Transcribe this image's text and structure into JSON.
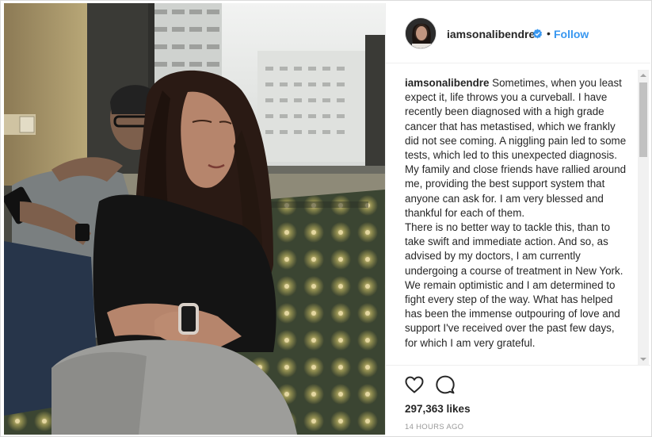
{
  "post": {
    "username": "iamsonalibendre",
    "dot": "•",
    "follow_label": "Follow",
    "caption_username": "iamsonalibendre",
    "caption_para1": "Sometimes, when you least expect it, life throws you a curveball. I have recently been diagnosed with a high grade cancer that has metastised, which we frankly did not see coming. A niggling pain led to some tests, which led to this unexpected diagnosis. My family and close friends have rallied around me, providing the best support system that anyone can ask for. I am very blessed and thankful for each of them.",
    "caption_para2": "There is no better way to tackle this, than to take swift and immediate action. And so, as advised by my doctors, I am currently undergoing a course of treatment in New York. We remain optimistic and I am determined to fight every step of the way. What has helped has been the immense outpouring of love and support I've received over the past few days, for which I am very grateful.",
    "likes": "297,363 likes",
    "timestamp": "14 HOURS AGO"
  },
  "icons": {
    "verified": "verified-badge-icon",
    "like": "heart-icon",
    "comment": "comment-bubble-icon"
  },
  "colors": {
    "link_blue": "#3897f0",
    "text": "#262626",
    "muted": "#999999",
    "border": "#dbdbdb"
  }
}
